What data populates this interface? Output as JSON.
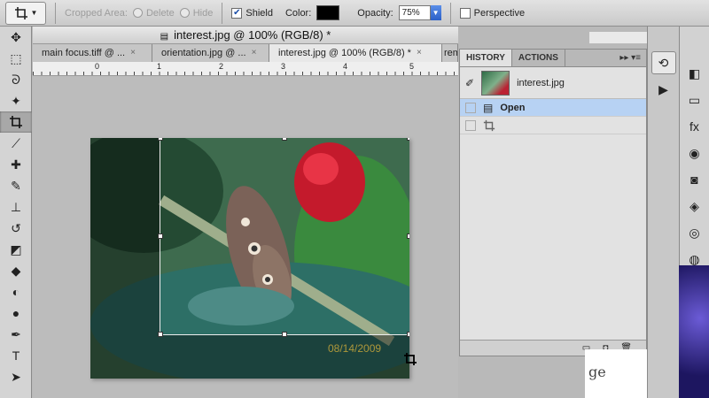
{
  "options_bar": {
    "cropped_area_label": "Cropped Area:",
    "delete_label": "Delete",
    "hide_label": "Hide",
    "shield_label": "Shield",
    "color_label": "Color:",
    "opacity_label": "Opacity:",
    "opacity_value": "75%",
    "perspective_label": "Perspective",
    "shield_checked": true,
    "shield_color": "#000000"
  },
  "document": {
    "title": "interest.jpg @ 100% (RGB/8) *",
    "tabs": [
      {
        "label": "main focus.tiff @ ...",
        "active": false
      },
      {
        "label": "orientation.jpg @ ...",
        "active": false
      },
      {
        "label": "interest.jpg @ 100% (RGB/8) *",
        "active": true
      },
      {
        "label": "rem",
        "active": false
      }
    ],
    "ruler_marks": [
      "0",
      "1",
      "2",
      "3",
      "4",
      "5"
    ],
    "date_stamp": "08/14/2009"
  },
  "history_panel": {
    "tabs": [
      "HISTORY",
      "ACTIONS"
    ],
    "active_tab": "HISTORY",
    "snapshot_name": "interest.jpg",
    "states": [
      {
        "label": "Open",
        "selected": true
      },
      {
        "label": "",
        "selected": false
      }
    ]
  },
  "webpage_fragment": "ge"
}
